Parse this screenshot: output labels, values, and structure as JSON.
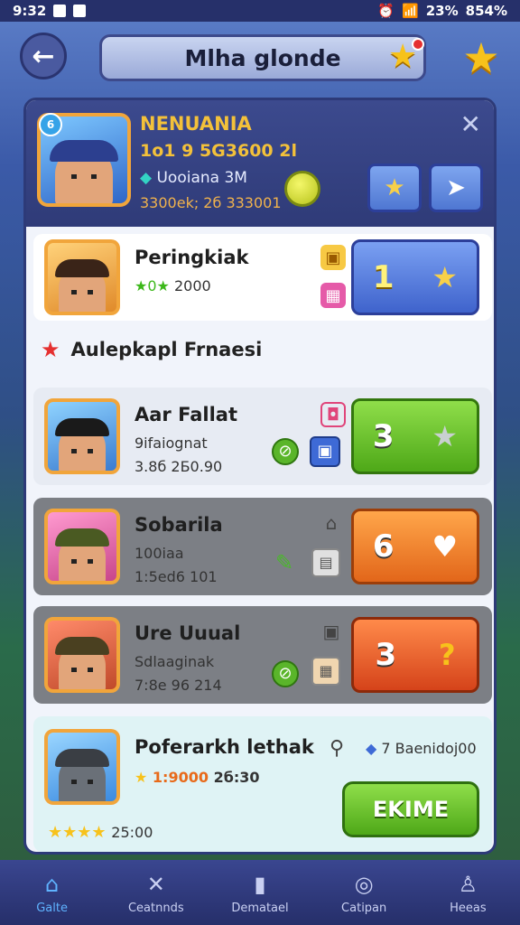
{
  "status": {
    "time": "9:32",
    "battery": "23%",
    "signal": "854%"
  },
  "header": {
    "title": "Mlha glonde"
  },
  "profile": {
    "name": "NENUANIA",
    "line1": "1o1 9 5G3600 2l",
    "line2": "Uooiana 3M",
    "line3": "3300ek; 2б 333001",
    "level": "6"
  },
  "rows": [
    {
      "name": "Peringkiak",
      "sub": "2000",
      "rank": "1"
    },
    {
      "name": "Aar Fallat",
      "sub": "9ifaiognat",
      "sub2": "3.8б 2Б0.90",
      "rank": "3"
    },
    {
      "name": "Sobarila",
      "sub": "100iaa",
      "sub2": "1:5ed6 101",
      "rank": "6"
    },
    {
      "name": "Ure Uuual",
      "sub": "Sdlaaginak",
      "sub2": "7:8e 96 214",
      "rank": "3"
    },
    {
      "name": "Poferarkh lethak",
      "sub": "1:9000",
      "sub2": "2б:30",
      "extra": "7 Baenidoj00",
      "stars_text": "25:00",
      "button": "EKIME"
    }
  ],
  "section_title": "Aulepkapl Frnaesi",
  "tabs": [
    {
      "label": "Galte",
      "icon": "home-icon",
      "active": true
    },
    {
      "label": "Ceatnnds",
      "icon": "swords-icon"
    },
    {
      "label": "Dematael",
      "icon": "card-icon"
    },
    {
      "label": "Catipan",
      "icon": "badge-icon"
    },
    {
      "label": "Heeas",
      "icon": "person-icon"
    }
  ],
  "colors": {
    "accent": "#f3c13a",
    "panel": "#f1f4fb",
    "header": "#3c4a8e"
  }
}
